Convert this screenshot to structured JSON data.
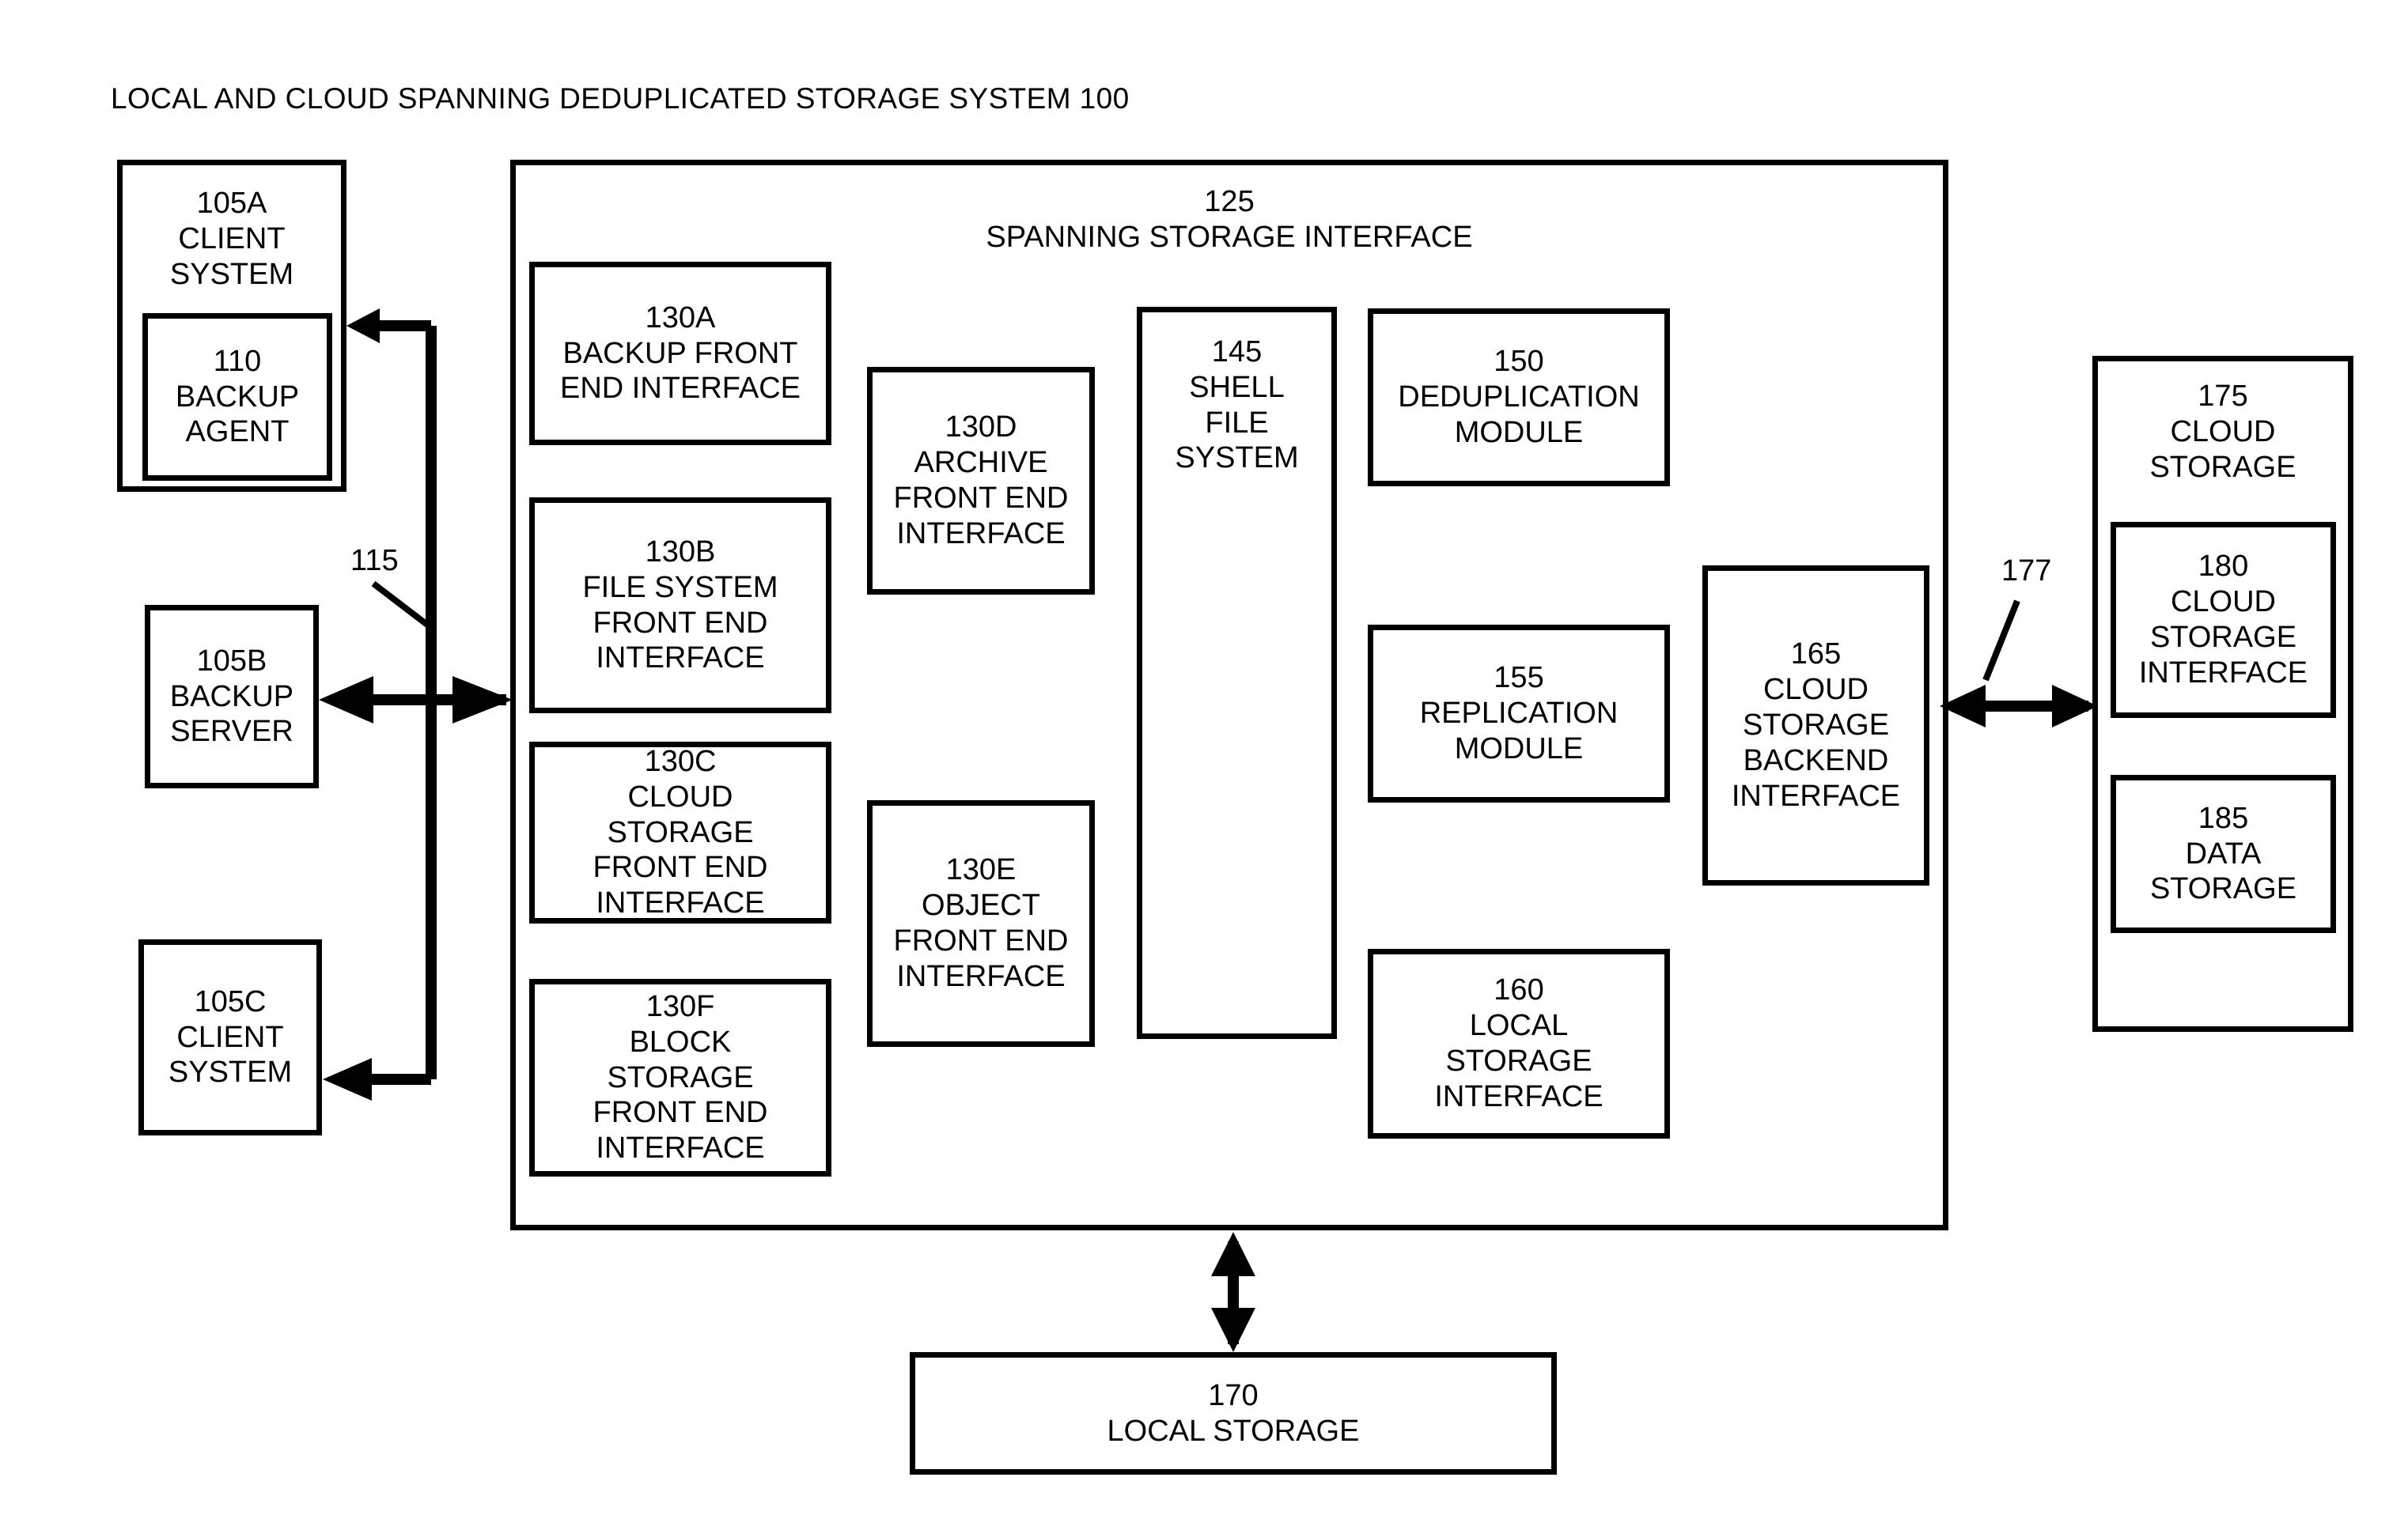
{
  "figure": {
    "title": "LOCAL AND CLOUD SPANNING DEDUPLICATED STORAGE SYSTEM 100",
    "stroke_color": "#000000",
    "background_color": "#ffffff"
  },
  "clients": {
    "client_a": {
      "ref": "105A",
      "name": "CLIENT\nSYSTEM",
      "label": "105A\nCLIENT\nSYSTEM"
    },
    "backup_agent": {
      "ref": "110",
      "name": "BACKUP\nAGENT",
      "label": "110\nBACKUP\nAGENT"
    },
    "backup_server": {
      "ref": "105B",
      "name": "BACKUP\nSERVER",
      "label": "105B\nBACKUP\nSERVER"
    },
    "client_c": {
      "ref": "105C",
      "name": "CLIENT\nSYSTEM",
      "label": "105C\nCLIENT\nSYSTEM"
    }
  },
  "connectors": {
    "client_bus": {
      "ref": "115",
      "label": "115"
    },
    "cloud_link": {
      "ref": "177",
      "label": "177"
    }
  },
  "spanning_storage_interface": {
    "ref": "125",
    "name": "SPANNING STORAGE INTERFACE",
    "label": "125\nSPANNING STORAGE INTERFACE",
    "front_end_interfaces": [
      {
        "ref": "130A",
        "name": "BACKUP FRONT\nEND INTERFACE",
        "label": "130A\nBACKUP FRONT\nEND INTERFACE"
      },
      {
        "ref": "130B",
        "name": "FILE SYSTEM\nFRONT END\nINTERFACE",
        "label": "130B\nFILE SYSTEM\nFRONT END\nINTERFACE"
      },
      {
        "ref": "130C",
        "name": "CLOUD\nSTORAGE\nFRONT END\nINTERFACE",
        "label": "130C\nCLOUD\nSTORAGE\nFRONT END\nINTERFACE"
      },
      {
        "ref": "130F",
        "name": "BLOCK\nSTORAGE\nFRONT END\nINTERFACE",
        "label": "130F\nBLOCK\nSTORAGE\nFRONT END\nINTERFACE"
      },
      {
        "ref": "130D",
        "name": "ARCHIVE\nFRONT END\nINTERFACE",
        "label": "130D\nARCHIVE\nFRONT END\nINTERFACE"
      },
      {
        "ref": "130E",
        "name": "OBJECT\nFRONT END\nINTERFACE",
        "label": "130E\nOBJECT\nFRONT END\nINTERFACE"
      }
    ],
    "shell_file_system": {
      "ref": "145",
      "name": "SHELL\nFILE\nSYSTEM",
      "label": "145\nSHELL\nFILE\nSYSTEM"
    },
    "modules": [
      {
        "ref": "150",
        "name": "DEDUPLICATION\nMODULE",
        "label": "150\nDEDUPLICATION\nMODULE"
      },
      {
        "ref": "155",
        "name": "REPLICATION\nMODULE",
        "label": "155\nREPLICATION\nMODULE"
      },
      {
        "ref": "160",
        "name": "LOCAL\nSTORAGE\nINTERFACE",
        "label": "160\nLOCAL\nSTORAGE\nINTERFACE"
      }
    ],
    "cloud_backend": {
      "ref": "165",
      "name": "CLOUD\nSTORAGE\nBACKEND\nINTERFACE",
      "label": "165\nCLOUD\nSTORAGE\nBACKEND\nINTERFACE"
    }
  },
  "local_storage": {
    "ref": "170",
    "name": "LOCAL STORAGE",
    "label": "170\nLOCAL STORAGE"
  },
  "cloud_storage": {
    "ref": "175",
    "name": "CLOUD\nSTORAGE",
    "label": "175\nCLOUD\nSTORAGE",
    "cloud_storage_interface": {
      "ref": "180",
      "name": "CLOUD\nSTORAGE\nINTERFACE",
      "label": "180\nCLOUD\nSTORAGE\nINTERFACE"
    },
    "data_storage": {
      "ref": "185",
      "name": "DATA\nSTORAGE",
      "label": "185\nDATA\nSTORAGE"
    }
  }
}
